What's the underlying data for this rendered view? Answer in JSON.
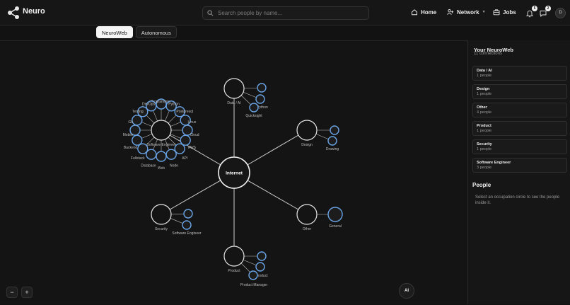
{
  "app": {
    "name": "Neuro"
  },
  "search": {
    "placeholder": "Search people by name..."
  },
  "nav": {
    "home": "Home",
    "network": "Network",
    "jobs": "Jobs",
    "notifications_count": "5",
    "messages_count": "2",
    "avatar_initial": "D"
  },
  "tabs": [
    {
      "label": "NeuroWeb",
      "active": true
    },
    {
      "label": "Autonomous",
      "active": false
    }
  ],
  "graph": {
    "hub": "Internet",
    "occupations": [
      {
        "label": "Data / AI",
        "children": [
          "",
          "Python",
          "Quicksight"
        ]
      },
      {
        "label": "Design",
        "children": [
          "",
          "Drawing"
        ]
      },
      {
        "label": "Other",
        "children": [
          "General"
        ]
      },
      {
        "label": "Product",
        "children": [
          "",
          "Product",
          "Product Manager"
        ]
      },
      {
        "label": "Security",
        "children": [
          "",
          "Software Engineer"
        ]
      },
      {
        "label": "Software Engineer",
        "children": [
          "Programming",
          "Python",
          "Postgresql",
          "Linux",
          "Cloud",
          "AWS",
          "API",
          "Node",
          "Web",
          "Database",
          "Fullstack",
          "Backend",
          "Mobile",
          "Git",
          "Testing",
          "DevOps"
        ]
      }
    ]
  },
  "controls": {
    "zoom_out": "−",
    "zoom_in": "+",
    "ai": "AI"
  },
  "panel": {
    "title": "Your NeuroWeb",
    "subtitle": "11 connections",
    "cards": [
      {
        "name": "Data / AI",
        "count": "1 people"
      },
      {
        "name": "Design",
        "count": "1 people"
      },
      {
        "name": "Other",
        "count": "4 people"
      },
      {
        "name": "Product",
        "count": "1 people"
      },
      {
        "name": "Security",
        "count": "1 people"
      },
      {
        "name": "Software Engineer",
        "count": "3 people"
      }
    ],
    "people_title": "People",
    "people_help": "Select an occupation circle to see the people inside it."
  }
}
